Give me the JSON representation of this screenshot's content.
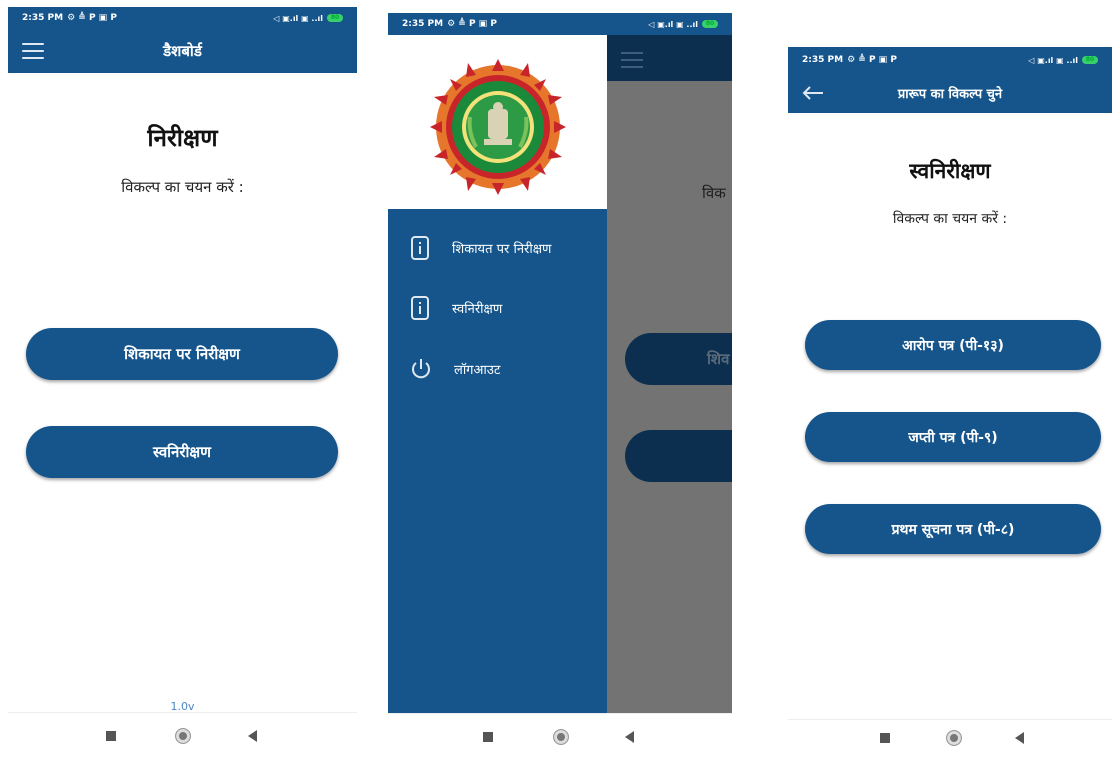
{
  "status_bar": {
    "time": "2:35 PM",
    "icons_left": "⚙ ≜ P ▣ P",
    "icons_right": "◁ ▣.ıl ▣ ..ıl",
    "battery": "80"
  },
  "screen1": {
    "appbar_title": "डैशबोर्ड",
    "heading": "निरीक्षण",
    "subtitle": "विकल्प का चयन करें :",
    "buttons": [
      "शिकायत पर निरीक्षण",
      "स्वनिरीक्षण"
    ],
    "version": "1.0v"
  },
  "screen2": {
    "menu": [
      {
        "label": "शिकायत पर निरीक्षण",
        "icon": "info-icon"
      },
      {
        "label": "स्वनिरीक्षण",
        "icon": "info-icon"
      },
      {
        "label": "लॉगआउट",
        "icon": "power-icon"
      }
    ],
    "peek_subtitle": "विक",
    "peek_button": "शिव"
  },
  "screen3": {
    "appbar_title": "प्रारूप का विकल्प चुने",
    "heading": "स्वनिरीक्षण",
    "subtitle": "विकल्प का चयन करें :",
    "buttons": [
      "आरोप पत्र (पी-१३)",
      "जप्ती पत्र (पी-९)",
      "प्रथम सूचना पत्र (पी-८)"
    ]
  },
  "colors": {
    "primary": "#16558b",
    "overlay": "#737373",
    "logo_green": "#1a8a3a",
    "logo_orange": "#e5762b",
    "logo_red": "#c8252b"
  }
}
